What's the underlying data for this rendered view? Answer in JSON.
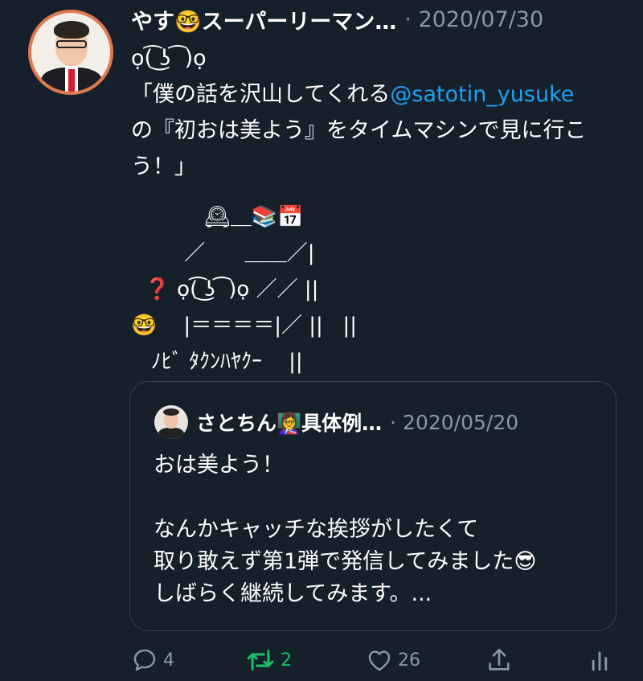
{
  "tweet": {
    "author_name": "やす🤓スーパーリーマン…",
    "meta": "· 2020/07/30",
    "text_before_mention": "ọ(͡ ͜ʖ ͡ )ọ\n「僕の話を沢山してくれる",
    "mention": "@satotin_yusuke",
    "text_after_mention": "\nの『初おは美よう』をタイムマシンで見に行こう！」",
    "art_line1": "           🕰＿📚📅",
    "art_line2": "        ／      ＿＿／|",
    "art_line4": "    |＝＝＝＝|／ ||   ||",
    "art_line5": "   ﾉﾋﾞ ﾀｸﾝﾊﾔｸｰ    ||",
    "art_q": "  ❓ ",
    "art_face": "ọ(͡ ͜ʖ ͡ )ọ ／／ ||",
    "art_nerd": "🤓"
  },
  "quote": {
    "author_name": "さとちん👩‍🏫具体例…",
    "meta": "· 2020/05/20",
    "text": "おは美よう！\n\nなんかキャッチな挨拶がしたくて\n取り敢えず第1弾で発信してみました😎\nしばらく継続してみます。..."
  },
  "actions": {
    "reply_count": "4",
    "retweet_count": "2",
    "like_count": "26"
  },
  "colors": {
    "background": "#15202b",
    "secondary_text": "#8899a6",
    "link": "#1da1f2",
    "retweet_active": "#17bf63",
    "border": "#38444d"
  }
}
